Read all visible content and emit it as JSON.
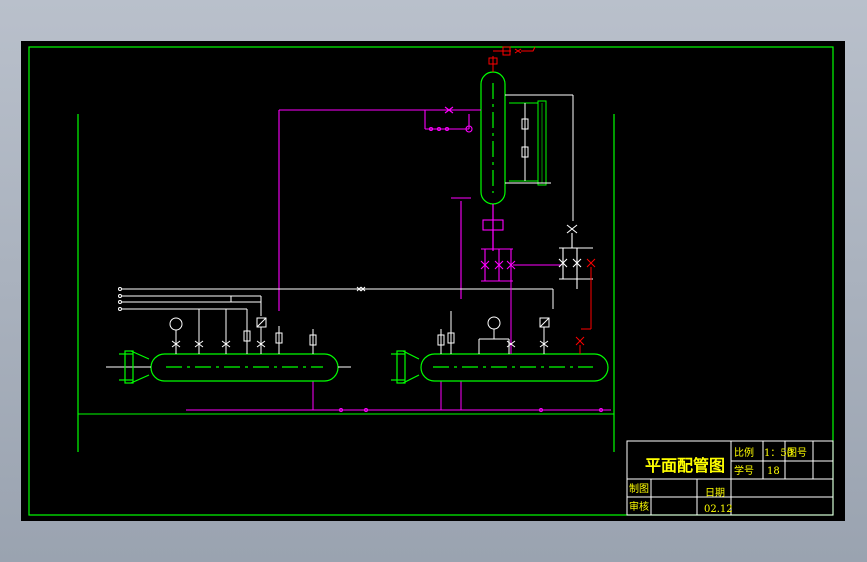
{
  "title_block": {
    "drawing_title": "平面配管图",
    "scale_label": "比例",
    "scale_value": "1：50",
    "drawing_no_label": "图号",
    "student_no_label": "学号",
    "student_no_value": "18",
    "drafter_label": "制图",
    "date_label": "日期",
    "reviewer_label": "审核",
    "date_value": "02.12"
  },
  "colors": {
    "background": "#000000",
    "frame": "#00ff00",
    "process_pipe": "#ff00ff",
    "instrument_line": "#ffffff",
    "relief_line": "#ff0000",
    "title_text": "#ffff00"
  }
}
